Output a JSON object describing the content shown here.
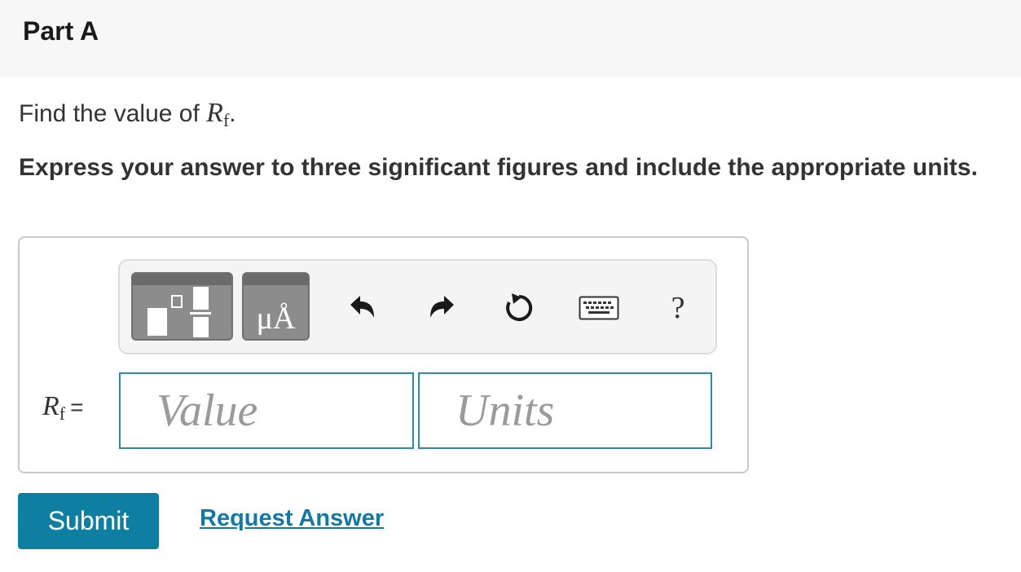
{
  "part": {
    "title": "Part A"
  },
  "question": {
    "prefix": "Find the value of ",
    "var_symbol": "R",
    "var_subscript": "f",
    "suffix": "."
  },
  "instruction": "Express your answer to three significant figures and include the appropriate units.",
  "toolbar": {
    "units_symbol": "μÅ",
    "help_symbol": "?"
  },
  "answer": {
    "label_symbol": "R",
    "label_subscript": "f",
    "label_equals": "=",
    "value_placeholder": "Value",
    "units_placeholder": "Units"
  },
  "actions": {
    "submit_label": "Submit",
    "request_answer_label": "Request Answer"
  },
  "colors": {
    "accent": "#0e7ea1",
    "input_border": "#2f8aa8",
    "toolbar_button": "#8c8c8c"
  }
}
